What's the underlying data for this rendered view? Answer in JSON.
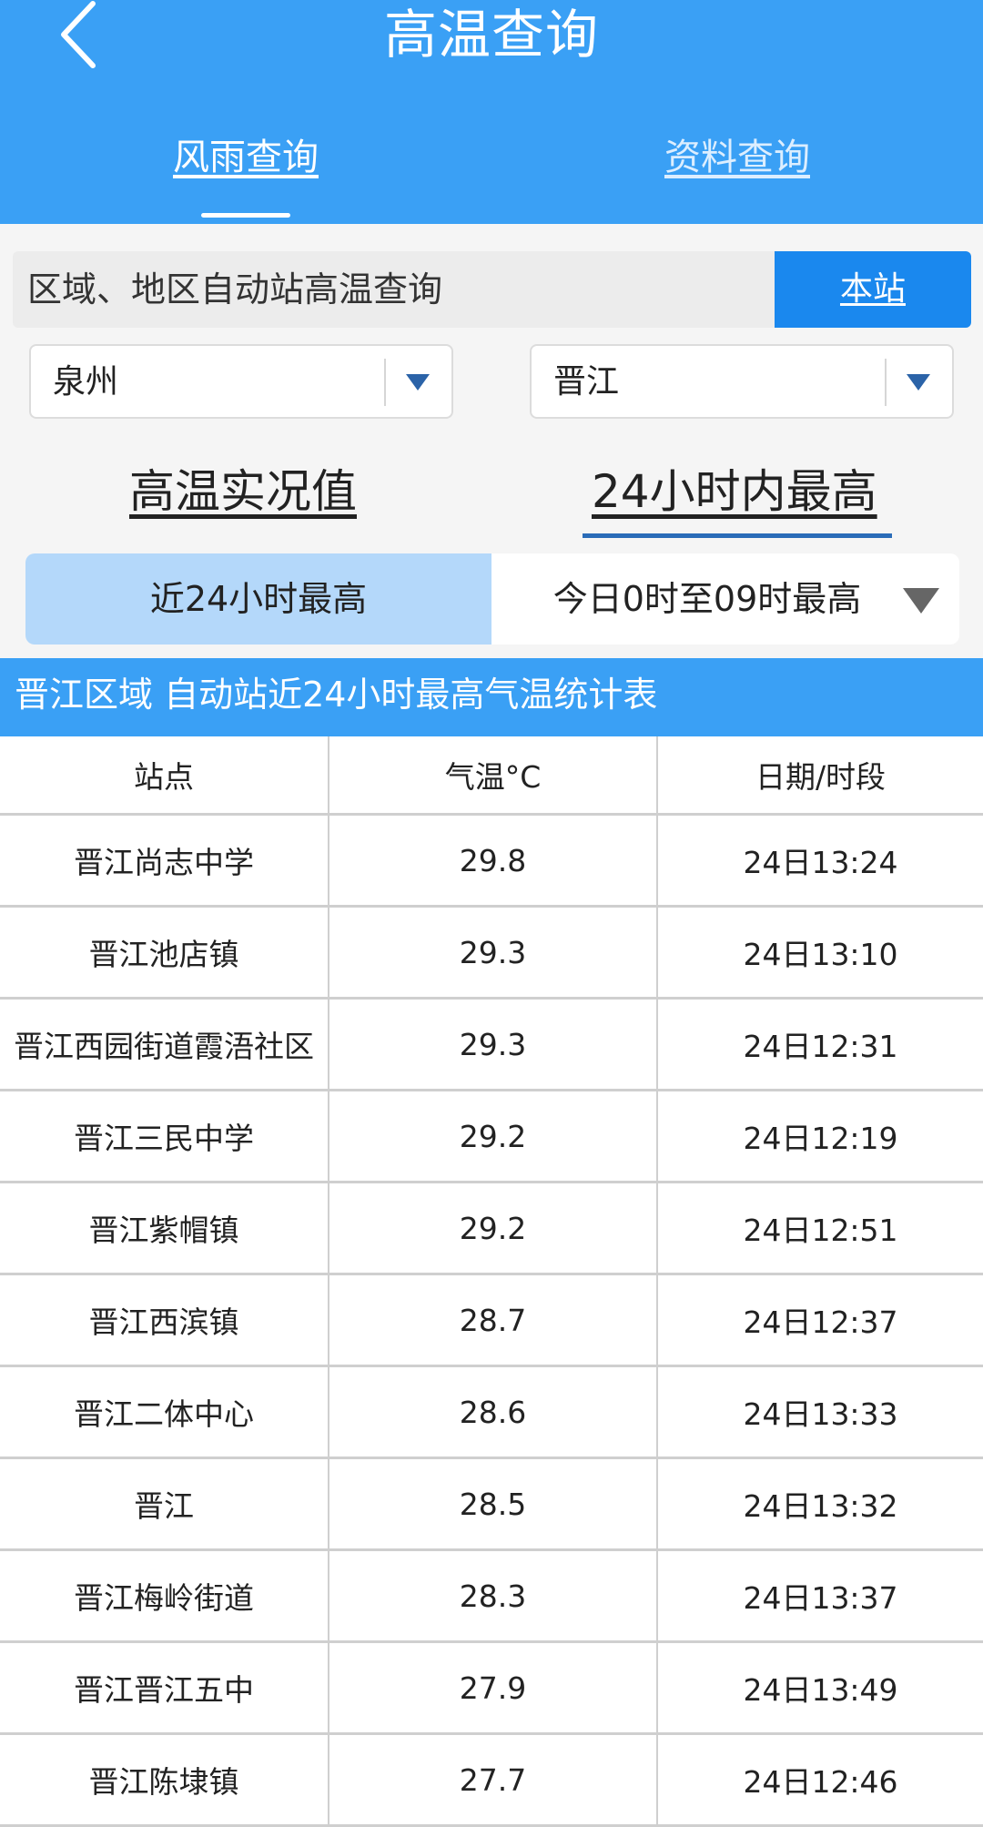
{
  "header": {
    "title": "高温查询",
    "back_icon": "chevron-left-icon",
    "tabs": [
      {
        "label": "风雨查询",
        "active": true
      },
      {
        "label": "资料查询",
        "active": false
      }
    ]
  },
  "query": {
    "label": "区域、地区自动站高温查询",
    "station_button": "本站"
  },
  "selects": {
    "city": "泉州",
    "district": "晋江"
  },
  "mode_tabs": [
    {
      "label": "高温实况值",
      "active": false
    },
    {
      "label": "24小时内最高",
      "active": true
    }
  ],
  "segment": {
    "left": "近24小时最高",
    "right": "今日0时至09时最高",
    "selected": "left"
  },
  "table": {
    "title": "晋江区域 自动站近24小时最高气温统计表",
    "columns": [
      "站点",
      "气温°C",
      "日期/时段"
    ],
    "rows": [
      [
        "晋江尚志中学",
        "29.8",
        "24日13:24"
      ],
      [
        "晋江池店镇",
        "29.3",
        "24日13:10"
      ],
      [
        "晋江西园街道霞浯社区",
        "29.3",
        "24日12:31"
      ],
      [
        "晋江三民中学",
        "29.2",
        "24日12:19"
      ],
      [
        "晋江紫帽镇",
        "29.2",
        "24日12:51"
      ],
      [
        "晋江西滨镇",
        "28.7",
        "24日12:37"
      ],
      [
        "晋江二体中心",
        "28.6",
        "24日13:33"
      ],
      [
        "晋江",
        "28.5",
        "24日13:32"
      ],
      [
        "晋江梅岭街道",
        "28.3",
        "24日13:37"
      ],
      [
        "晋江晋江五中",
        "27.9",
        "24日13:49"
      ],
      [
        "晋江陈埭镇",
        "27.7",
        "24日12:46"
      ]
    ]
  },
  "colors": {
    "header_bg": "#3aa0f5",
    "station_button_bg": "#1a88ee",
    "segment_selected_bg": "#b4d8fa",
    "dropdown_arrow": "#2b63a8"
  }
}
